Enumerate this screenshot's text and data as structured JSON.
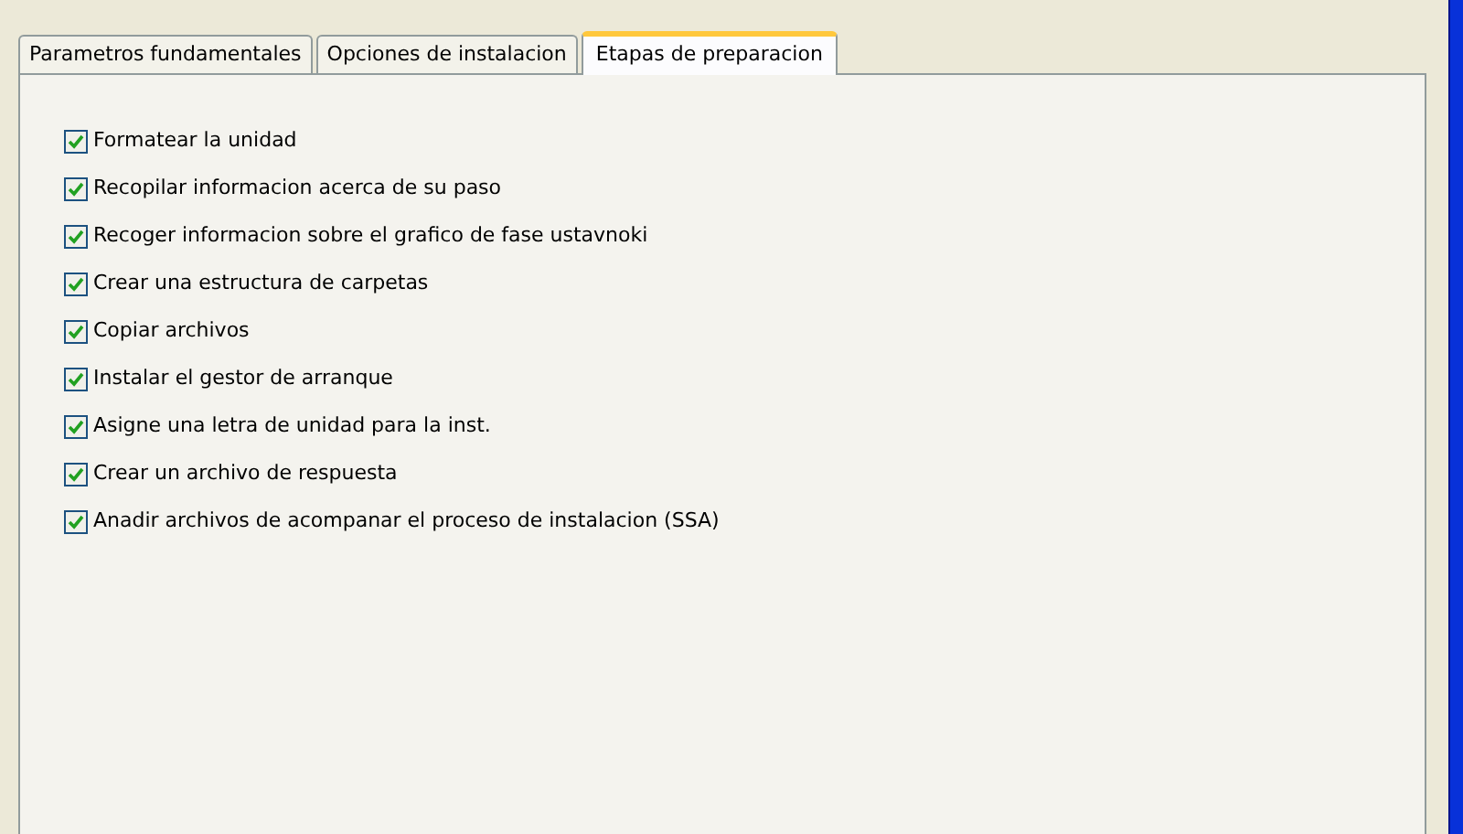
{
  "tabs": [
    {
      "label": "Parametros fundamentales",
      "selected": false
    },
    {
      "label": "Opciones de instalacion",
      "selected": false
    },
    {
      "label": "Etapas de preparacion",
      "selected": true
    }
  ],
  "steps": [
    {
      "label": "Formatear la unidad",
      "checked": true
    },
    {
      "label": "Recopilar informacion acerca de su paso",
      "checked": true
    },
    {
      "label": "Recoger informacion sobre el grafico de fase ustavnoki",
      "checked": true
    },
    {
      "label": "Crear una estructura de carpetas",
      "checked": true
    },
    {
      "label": "Copiar archivos",
      "checked": true
    },
    {
      "label": "Instalar el gestor de arranque",
      "checked": true
    },
    {
      "label": "Asigne una letra de unidad para la inst.",
      "checked": true
    },
    {
      "label": "Crear un archivo de respuesta",
      "checked": true
    },
    {
      "label": "Anadir archivos de acompanar el proceso de instalacion (SSA)",
      "checked": true
    }
  ]
}
